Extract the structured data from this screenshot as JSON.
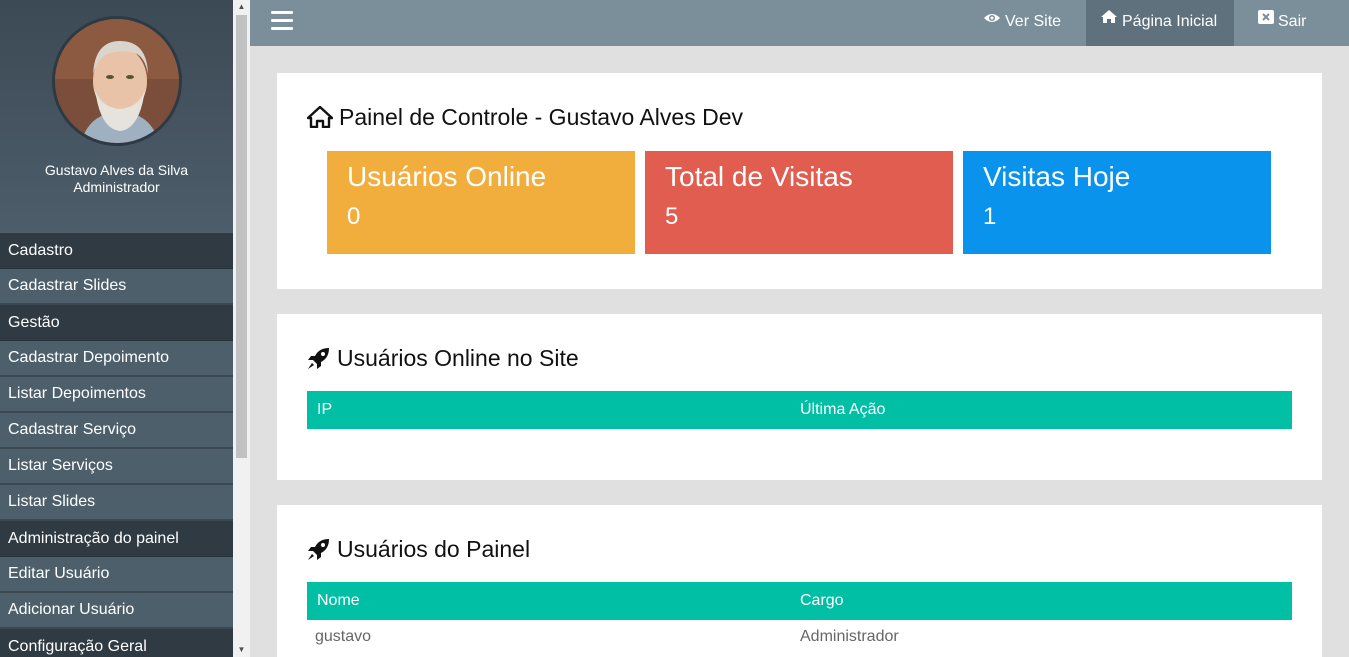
{
  "user": {
    "name": "Gustavo Alves da Silva",
    "role": "Administrador"
  },
  "sidebar": {
    "items": [
      {
        "type": "section",
        "label": "Cadastro"
      },
      {
        "type": "item",
        "label": "Cadastrar Slides"
      },
      {
        "type": "section",
        "label": "Gestão"
      },
      {
        "type": "item",
        "label": "Cadastrar Depoimento"
      },
      {
        "type": "item",
        "label": "Listar Depoimentos"
      },
      {
        "type": "item",
        "label": "Cadastrar Serviço"
      },
      {
        "type": "item",
        "label": "Listar Serviços"
      },
      {
        "type": "item",
        "label": "Listar Slides"
      },
      {
        "type": "section",
        "label": "Administração do painel"
      },
      {
        "type": "item",
        "label": "Editar Usuário"
      },
      {
        "type": "item",
        "label": "Adicionar Usuário"
      },
      {
        "type": "section",
        "label": "Configuração Geral"
      }
    ]
  },
  "topbar": {
    "menu_icon": "hamburger-icon",
    "links": [
      {
        "label": "Ver Site",
        "icon": "eye-icon",
        "active": false
      },
      {
        "label": "Página Inicial",
        "icon": "home-icon",
        "active": true
      },
      {
        "label": "Sair",
        "icon": "close-box-icon",
        "active": false
      }
    ]
  },
  "dashboard": {
    "title": "Painel de Controle - Gustavo Alves Dev",
    "icon": "home-icon",
    "cards": [
      {
        "label": "Usuários Online",
        "value": "0",
        "color": "#f2ae3d"
      },
      {
        "label": "Total de Visitas",
        "value": "5",
        "color": "#e05d50"
      },
      {
        "label": "Visitas Hoje",
        "value": "1",
        "color": "#0a93ec"
      }
    ]
  },
  "online_users": {
    "title": "Usuários Online no Site",
    "icon": "rocket-icon",
    "columns": [
      "IP",
      "Última Ação"
    ],
    "rows": []
  },
  "panel_users": {
    "title": "Usuários do Painel",
    "icon": "rocket-icon",
    "columns": [
      "Nome",
      "Cargo"
    ],
    "rows": [
      {
        "name": "gustavo",
        "role": "Administrador"
      }
    ]
  },
  "colors": {
    "sidebar": "#4b5b68",
    "sidebar_section": "#2f3a42",
    "topbar": "#7b8f9b",
    "table_header": "#00bfa5"
  }
}
